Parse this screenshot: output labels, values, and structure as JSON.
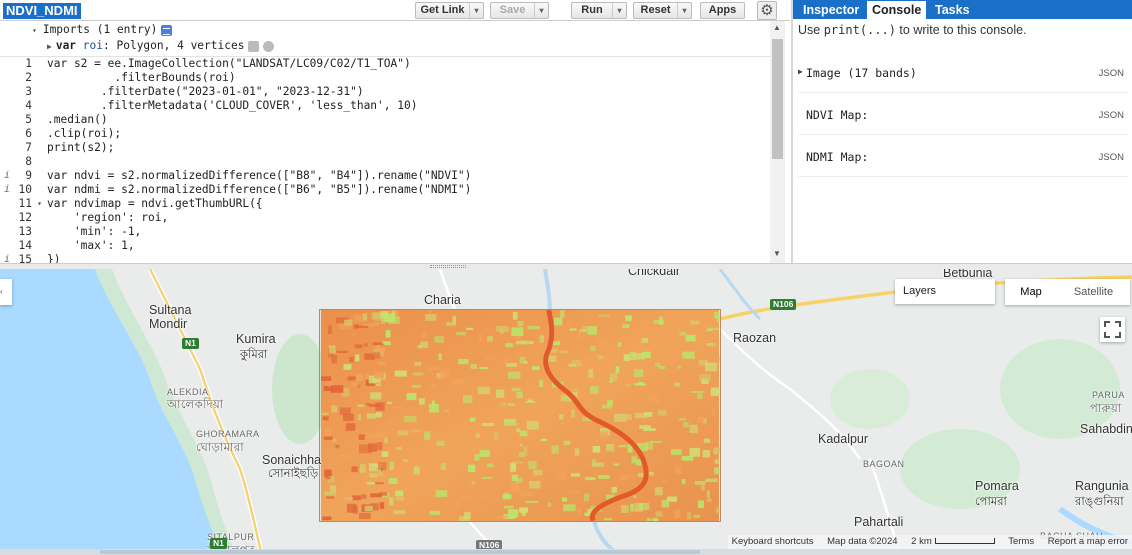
{
  "topbar": {
    "script_title": "NDVI_NDMI",
    "get_link": "Get Link",
    "save": "Save",
    "run": "Run",
    "reset": "Reset",
    "apps": "Apps",
    "caret": "▾",
    "gear": "⚙"
  },
  "imports": {
    "header": "Imports (1 entry)",
    "var_keyword": "var",
    "var_name": "roi",
    "var_desc": ": Polygon, 4 vertices"
  },
  "gutter": {
    "line_numbers": [
      "1",
      "2",
      "3",
      "4",
      "5",
      "6",
      "7",
      "8",
      "9",
      "10",
      "11",
      "12",
      "13",
      "14",
      "15"
    ],
    "info_mark": "i",
    "fold_mark": "▾"
  },
  "code_lines": [
    "var s2 = ee.ImageCollection(\"LANDSAT/LC09/C02/T1_TOA\")",
    "          .filterBounds(roi)",
    "        .filterDate(\"2023-01-01\", \"2023-12-31\")",
    "        .filterMetadata('CLOUD_COVER', 'less_than', 10)",
    ".median()",
    ".clip(roi);",
    "print(s2);",
    "",
    "var ndvi = s2.normalizedDifference([\"B8\", \"B4\"]).rename(\"NDVI\")",
    "var ndmi = s2.normalizedDifference([\"B6\", \"B5\"]).rename(\"NDMI\")",
    "var ndvimap = ndvi.getThumbURL({",
    "    'region': roi,",
    "    'min': -1,",
    "    'max': 1,",
    "})"
  ],
  "right_panel": {
    "tabs": [
      "Inspector",
      "Console",
      "Tasks"
    ],
    "active_tab": "Console",
    "hint_prefix": "Use ",
    "hint_code": "print(...)",
    "hint_suffix": " to write to this console.",
    "entries": [
      {
        "label": "Image (17 bands)",
        "expandable": true,
        "json": "JSON"
      },
      {
        "label": "NDVI Map:",
        "expandable": false,
        "json": "JSON"
      },
      {
        "label": "NDMI Map:",
        "expandable": false,
        "json": "JSON"
      }
    ]
  },
  "map": {
    "places": [
      {
        "name": "Chickdair"
      },
      {
        "name": "Betbunia"
      },
      {
        "name": "Charia"
      },
      {
        "name": "Sultana"
      },
      {
        "name": "Mondir"
      },
      {
        "name": "Kumira"
      },
      {
        "name": "কুমিরা"
      },
      {
        "name": "ALEKDIA"
      },
      {
        "name": "আলেকদিয়া"
      },
      {
        "name": "GHORAMARA"
      },
      {
        "name": "ঘোড়ামারা"
      },
      {
        "name": "Sonaichha"
      },
      {
        "name": "সোনাইছড়ি"
      },
      {
        "name": "SITALPUR"
      },
      {
        "name": "সীতালপুর"
      },
      {
        "name": "Raozan"
      },
      {
        "name": "PARUA"
      },
      {
        "name": "পারুয়া"
      },
      {
        "name": "Sahabdin"
      },
      {
        "name": "Kadalpur"
      },
      {
        "name": "BAGOAN"
      },
      {
        "name": "Pomara"
      },
      {
        "name": "পোমরা"
      },
      {
        "name": "Rangunia"
      },
      {
        "name": "রাঙ্গুনিয়া"
      },
      {
        "name": "Pahartali"
      },
      {
        "name": "BACHA SHAH"
      }
    ],
    "road_shields": [
      "N106",
      "N1",
      "N1",
      "N106"
    ],
    "layers_label": "Layers",
    "map_type": [
      "Map",
      "Satellite"
    ],
    "active_map_type": "Map",
    "attribution": {
      "shortcuts": "Keyboard shortcuts",
      "data": "Map data ©2024",
      "scale": "2 km",
      "terms": "Terms",
      "report": "Report a map error"
    },
    "colors": {
      "water": "#aadaff",
      "land": "#e9ecea",
      "ndvi_low": "#e0653a",
      "ndvi_mid": "#f2a35a",
      "ndvi_high": "#b8e86a",
      "river": "#e05a2e"
    }
  }
}
